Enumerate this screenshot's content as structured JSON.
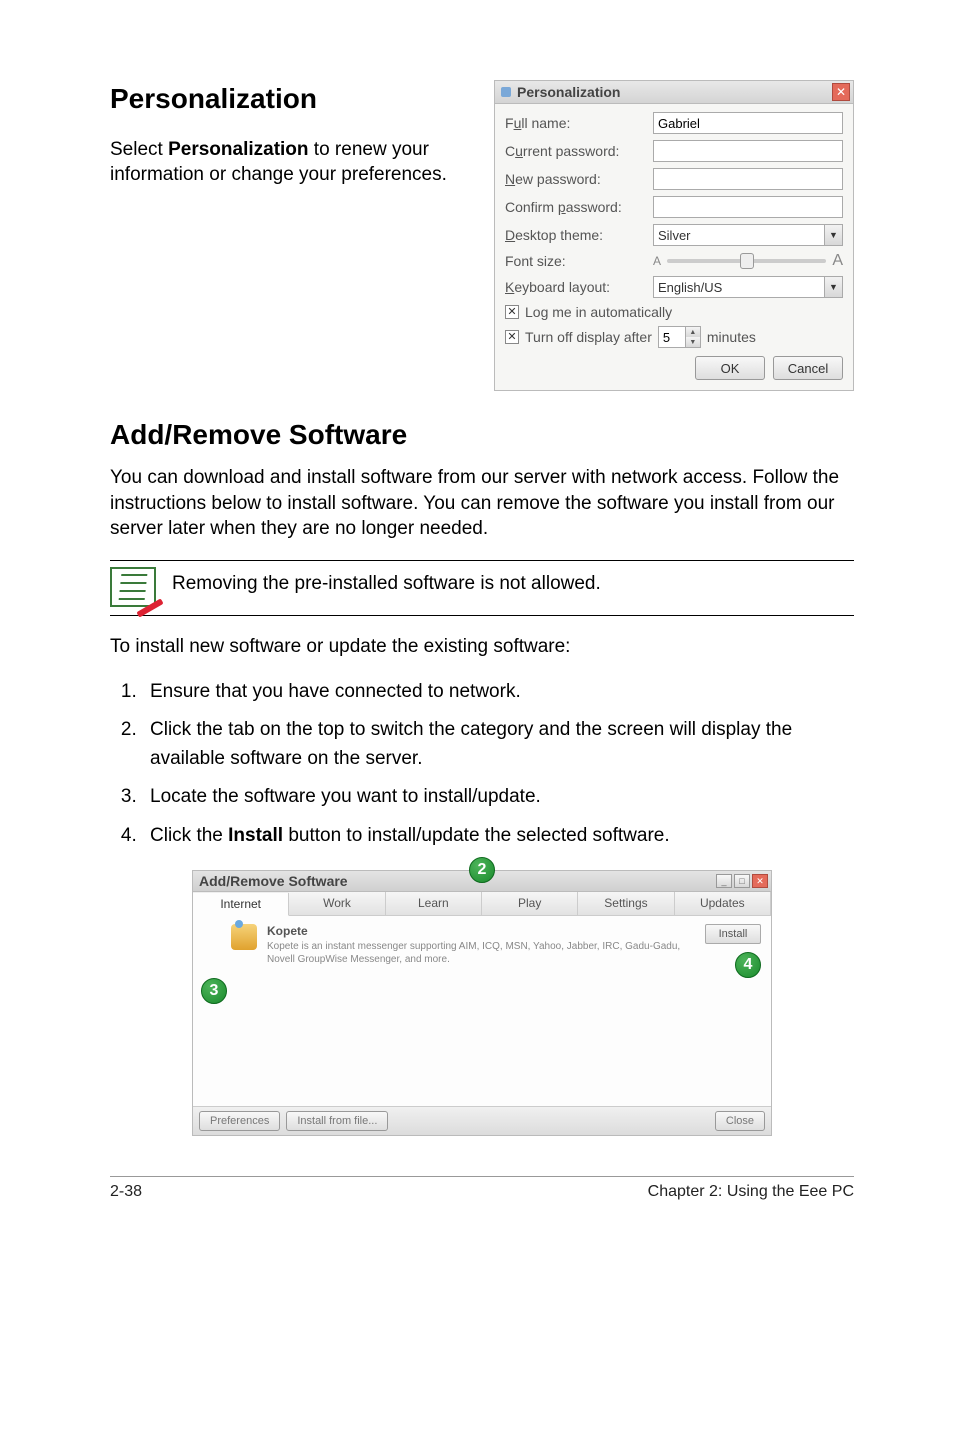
{
  "sections": {
    "personalization": {
      "title": "Personalization",
      "intro_pre": "Select ",
      "intro_bold": "Personalization",
      "intro_post": " to renew your information or change your preferences."
    },
    "addremove": {
      "title": "Add/Remove Software",
      "body": "You can download and install software from our server with network access. Follow the instructions below to install software. You can remove the software you install from our server later when they are no longer needed.",
      "note": "Removing the pre-installed software is not allowed.",
      "lead": "To install new software or update the existing software:",
      "steps": [
        "Ensure that you have connected to network.",
        "Click the tab on the top to switch the category and the screen will display the available software on the server.",
        "Locate the software you want to install/update.",
        {
          "pre": "Click the ",
          "bold": "Install",
          "post": " button to install/update the selected software."
        }
      ]
    }
  },
  "personalization_dialog": {
    "title": "Personalization",
    "fields": {
      "full_name": {
        "label_pre": "F",
        "label_ul": "u",
        "label_post": "ll name:",
        "value": "Gabriel"
      },
      "current_pw": {
        "label_pre": "C",
        "label_ul": "u",
        "label_post": "rrent password:"
      },
      "new_pw": {
        "label_ul": "N",
        "label_post": "ew password:"
      },
      "confirm_pw": {
        "label_pre": "Confirm ",
        "label_ul": "p",
        "label_post": "assword:"
      },
      "theme": {
        "label_ul": "D",
        "label_post": "esktop theme:",
        "value": "Silver"
      },
      "font": {
        "label": "Font size:"
      },
      "keyboard": {
        "label_ul": "K",
        "label_post": "eyboard layout:",
        "value": "English/US"
      }
    },
    "check_login": {
      "label_pre": "Log me in ",
      "label_ul": "a",
      "label_post": "utomatically"
    },
    "display_off": {
      "label_ul": "T",
      "label_post": "urn off display after",
      "value": "5",
      "suffix": "minutes"
    },
    "buttons": {
      "ok_ul": "O",
      "ok_post": "K",
      "cancel": "Cancel"
    }
  },
  "software_window": {
    "title": "Add/Remove Software",
    "tabs": [
      "Internet",
      "Work",
      "Learn",
      "Play",
      "Settings",
      "Updates"
    ],
    "item": {
      "name": "Kopete",
      "desc": "Kopete is an instant messenger supporting AIM, ICQ, MSN, Yahoo, Jabber, IRC, Gadu-Gadu, Novell GroupWise Messenger, and more.",
      "install": "Install"
    },
    "footer": {
      "prefs_ul": "P",
      "prefs_post": "references",
      "install_ul": "I",
      "install_post": "nstall from file...",
      "close": "Close"
    },
    "callouts": {
      "c2": "2",
      "c3": "3",
      "c4": "4"
    }
  },
  "footer": {
    "left": "2-38",
    "right": "Chapter 2: Using the Eee PC"
  }
}
